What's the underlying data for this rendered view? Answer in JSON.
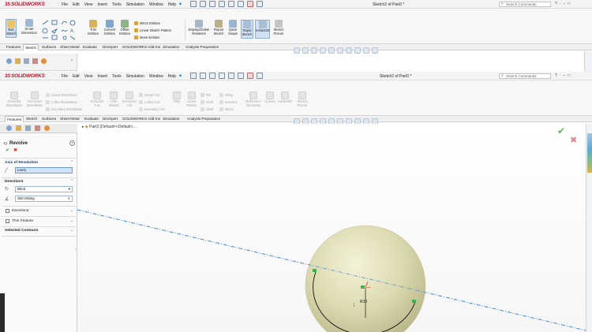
{
  "app": {
    "logo_ds": "3S",
    "logo_text": "SOLIDWORKS",
    "menus": [
      "File",
      "Edit",
      "View",
      "Insert",
      "Tools",
      "Simulation",
      "Window",
      "Help"
    ],
    "title_top": "Sketch2 of Part3 *",
    "title_main": "Sketch2 of Part3 *",
    "search_placeholder": "Search Commands"
  },
  "top_ribbon": {
    "buttons": [
      {
        "label": "Exit Sketch"
      },
      {
        "label": "Smart Dimension"
      },
      {
        "label": "Trim Entities"
      },
      {
        "label": "Convert Entities"
      },
      {
        "label": "Offset Entities"
      },
      {
        "label": "Display/Delete Relations"
      },
      {
        "label": "Repair Sketch"
      },
      {
        "label": "Quick Snaps"
      },
      {
        "label": "Rapid Sketch"
      },
      {
        "label": "Instant2D"
      },
      {
        "label": "Sketch Picture"
      }
    ],
    "small": [
      "Mirror Entities",
      "Linear Sketch Pattern",
      "Move Entities"
    ]
  },
  "tabs": [
    "Features",
    "Sketch",
    "Surfaces",
    "Sheet Metal",
    "Evaluate",
    "DimXpert",
    "SOLIDWORKS Add-Ins",
    "Simulation",
    "Analysis Preparation"
  ],
  "feature_ribbon": {
    "buttons": [
      {
        "label": "Extruded Boss/Base"
      },
      {
        "label": "Revolved Boss/Base"
      },
      {
        "label": "Extruded Cut"
      },
      {
        "label": "Hole Wizard"
      },
      {
        "label": "Revolved Cut"
      },
      {
        "label": "Fillet"
      },
      {
        "label": "Linear Pattern"
      },
      {
        "label": "Reference Geometry"
      },
      {
        "label": "Curves"
      },
      {
        "label": "Instant3D"
      },
      {
        "label": "Sketch Picture"
      }
    ],
    "small_left": [
      "Swept Boss/Base",
      "Lofted Boss/Base",
      "Boundary Boss/Base"
    ],
    "small_mid": [
      "Swept Cut",
      "Lofted Cut",
      "Boundary Cut"
    ],
    "small_right": [
      "Rib",
      "Draft",
      "Shell",
      "Wrap",
      "Intersect",
      "Mirror"
    ]
  },
  "tree": {
    "item": "Part3 (Default<<Default>..."
  },
  "property_manager": {
    "title": "Revolve",
    "help": "?",
    "ok": "✔",
    "cancel": "✖",
    "axis_header": "Axis of Revolution",
    "axis_value": "Line1",
    "direction1_header": "Direction1",
    "end_condition": "Blind",
    "angle": "360.00deg",
    "direction2_label": "Direction2",
    "thin_label": "Thin Feature",
    "contours_label": "Selected Contours"
  },
  "viewport": {
    "dimension_label": "R10",
    "accept": "✔",
    "reject": "✖"
  }
}
